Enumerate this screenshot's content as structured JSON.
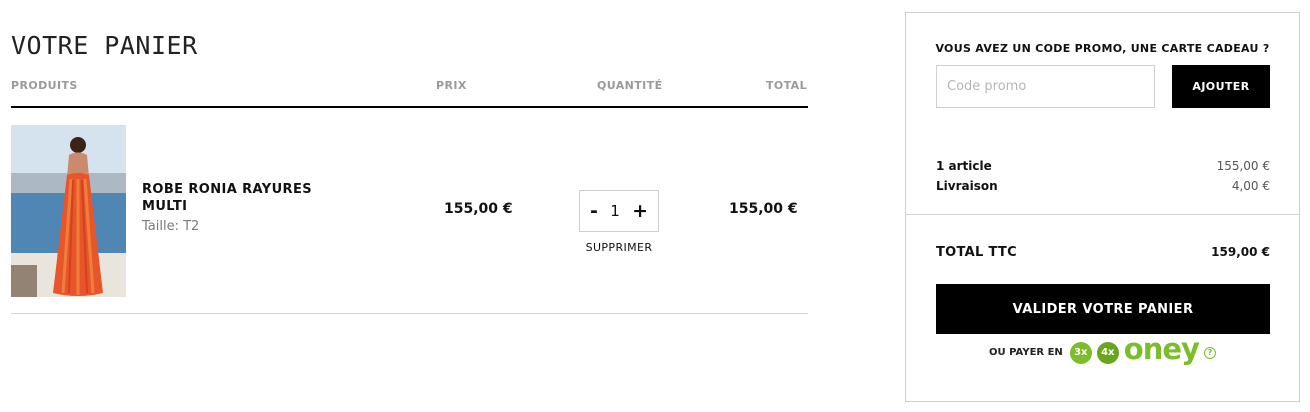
{
  "page": {
    "title": "VOTRE PANIER"
  },
  "table": {
    "headers": {
      "products": "PRODUITS",
      "price": "PRIX",
      "quantity": "QUANTITÉ",
      "total": "TOTAL"
    }
  },
  "cart": {
    "items": [
      {
        "name": "ROBE RONIA RAYURES MULTI",
        "size": "Taille: T2",
        "unit_price": "155,00 €",
        "quantity": "1",
        "line_total": "155,00 €",
        "remove_label": "SUPPRIMER",
        "decrement_label": "-",
        "increment_label": "+",
        "image_icon": "product-photo"
      }
    ]
  },
  "summary": {
    "promo_question": "VOUS AVEZ UN CODE PROMO, UNE CARTE CADEAU ?",
    "promo_placeholder": "Code promo",
    "promo_button": "AJOUTER",
    "articles_label": "1 article",
    "articles_value": "155,00 €",
    "shipping_label": "Livraison",
    "shipping_value": "4,00 €",
    "total_label": "TOTAL TTC",
    "total_value": "159,00 €",
    "checkout_button": "VALIDER VOTRE PANIER",
    "pay_with_label": "OU PAYER EN",
    "oney_3x": "3x",
    "oney_4x": "4x",
    "oney_logo": "oney",
    "help_icon": "?"
  },
  "colors": {
    "accent": "#000000",
    "oney_green": "#7dbd2a",
    "border": "#cfcfcf"
  }
}
